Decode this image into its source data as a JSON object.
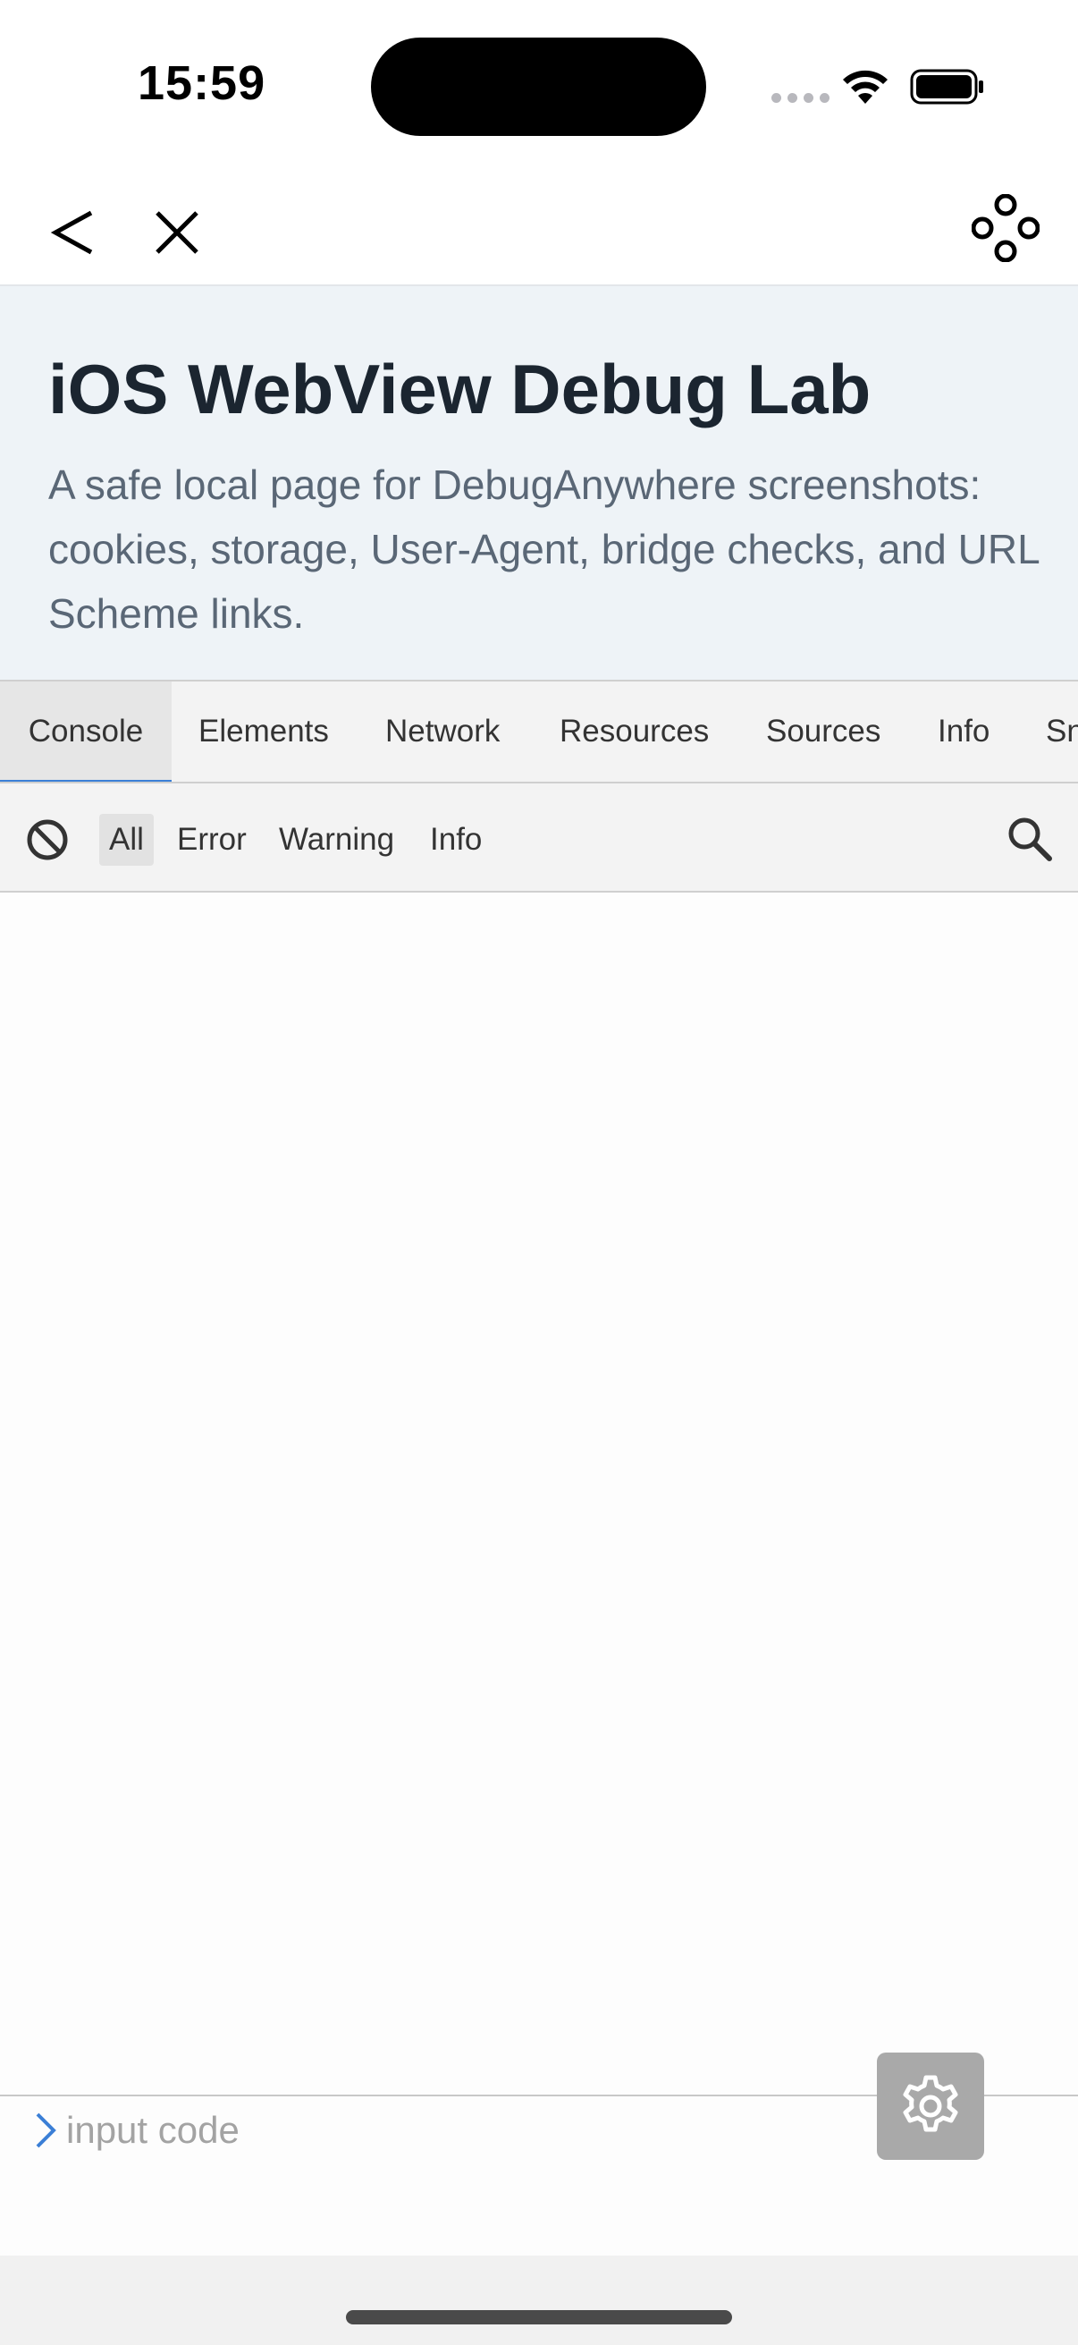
{
  "status_bar": {
    "time": "15:59"
  },
  "nav": {
    "back_icon": "chevron-left-icon",
    "close_icon": "close-icon",
    "tools_icon": "debug-tools-icon"
  },
  "web_page": {
    "title": "iOS WebView Debug Lab",
    "description": "A safe local page for DebugAnywhere screenshots: cookies, storage, User-Agent, bridge checks, and URL Scheme links."
  },
  "devtools": {
    "tabs": [
      {
        "label": "Console",
        "active": true
      },
      {
        "label": "Elements",
        "active": false
      },
      {
        "label": "Network",
        "active": false
      },
      {
        "label": "Resources",
        "active": false
      },
      {
        "label": "Sources",
        "active": false
      },
      {
        "label": "Info",
        "active": false
      },
      {
        "label": "Sn",
        "active": false
      }
    ],
    "filters": [
      {
        "label": "All",
        "active": true
      },
      {
        "label": "Error",
        "active": false
      },
      {
        "label": "Warning",
        "active": false
      },
      {
        "label": "Info",
        "active": false
      }
    ],
    "input": {
      "placeholder": "input code",
      "value": ""
    }
  },
  "colors": {
    "accent": "#3b7fd6",
    "header_bg": "#eef3f7",
    "title_text": "#1b2530",
    "desc_text": "#5a6776",
    "panel_bg": "#f3f3f3",
    "settings_bg": "#a9a9a9"
  }
}
